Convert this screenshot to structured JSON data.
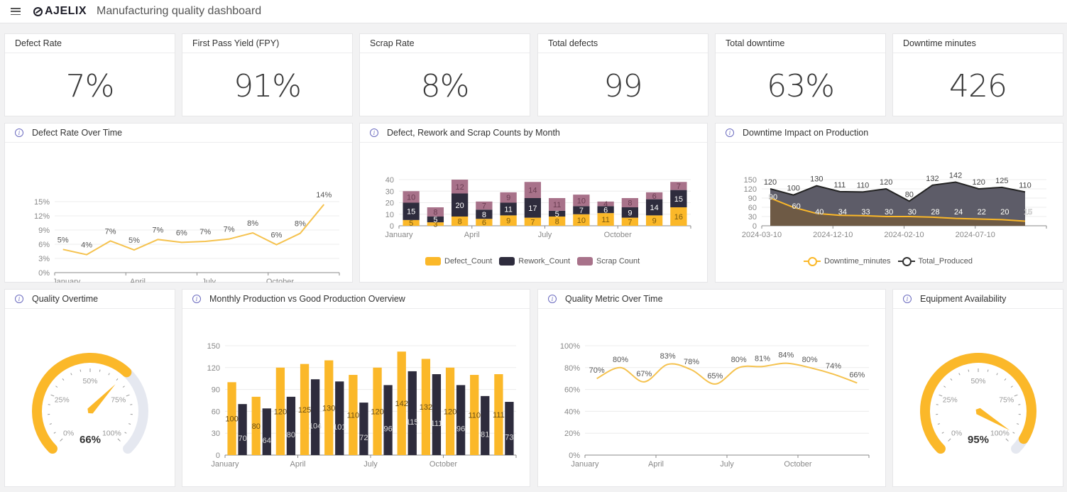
{
  "header": {
    "menu_icon": "hamburger-icon",
    "logo_text": "AJELIX",
    "title": "Manufacturing quality dashboard"
  },
  "kpis": [
    {
      "label": "Defect Rate",
      "value": "7%"
    },
    {
      "label": "First Pass Yield (FPY)",
      "value": "91%"
    },
    {
      "label": "Scrap Rate",
      "value": "8%"
    },
    {
      "label": "Total defects",
      "value": "99"
    },
    {
      "label": "Total downtime",
      "value": "63%"
    },
    {
      "label": "Downtime minutes",
      "value": "426"
    }
  ],
  "colors": {
    "accent": "#fbb829",
    "dark": "#2e2c3d",
    "scrap": "#a8728a",
    "area_dark": "#5d5c68",
    "area_brown": "#6e5a45",
    "grid": "#ececec"
  },
  "chart_data": [
    {
      "id": "defect_rate",
      "title": "Defect Rate Over Time",
      "type": "line",
      "categories": [
        "January",
        "February",
        "March",
        "April",
        "May",
        "June",
        "July",
        "August",
        "September",
        "October",
        "November",
        "December"
      ],
      "x_tick_labels": [
        "January",
        "April",
        "July",
        "October"
      ],
      "values": [
        4.9,
        3.8,
        6.7,
        4.8,
        7.0,
        6.4,
        6.6,
        7.1,
        8.4,
        5.9,
        8.3,
        14.4
      ],
      "data_labels": [
        "5%",
        "4%",
        "7%",
        "5%",
        "7%",
        "6%",
        "7%",
        "7%",
        "8%",
        "6%",
        "8%",
        "14%"
      ],
      "y_ticks": [
        "0%",
        "3%",
        "6%",
        "9%",
        "12%",
        "15%"
      ],
      "ylim": [
        0,
        15
      ],
      "grid": true
    },
    {
      "id": "counts_by_month",
      "title": "Defect, Rework and Scrap Counts by Month",
      "type": "bar",
      "stacked": true,
      "categories": [
        "January",
        "February",
        "March",
        "April",
        "May",
        "June",
        "July",
        "August",
        "September",
        "October",
        "November",
        "December"
      ],
      "x_tick_labels": [
        "January",
        "April",
        "July",
        "October"
      ],
      "series": [
        {
          "name": "Defect_Count",
          "values": [
            5,
            3,
            8,
            6,
            9,
            7,
            8,
            10,
            11,
            7,
            9,
            16
          ]
        },
        {
          "name": "Rework_Count",
          "values": [
            15,
            5,
            20,
            8,
            11,
            17,
            5,
            7,
            6,
            9,
            14,
            15
          ]
        },
        {
          "name": "Scrap Count",
          "values": [
            10,
            8,
            12,
            7,
            9,
            14,
            11,
            10,
            4,
            8,
            6,
            7
          ]
        }
      ],
      "y_ticks": [
        "0",
        "10",
        "20",
        "30",
        "40"
      ],
      "ylim": [
        0,
        40
      ],
      "legend": "bottom",
      "grid": true
    },
    {
      "id": "downtime_impact",
      "title": "Downtime Impact on Production",
      "type": "area",
      "x_tick_labels": [
        "2024-03-10",
        "2024-12-10",
        "2024-02-10",
        "2024-07-10"
      ],
      "series": [
        {
          "name": "Downtime_minutes",
          "values": [
            90,
            60,
            40,
            34,
            33,
            30,
            30,
            28,
            24,
            22,
            20,
            15
          ]
        },
        {
          "name": "Total_Produced",
          "values": [
            120,
            100,
            130,
            111,
            110,
            120,
            80,
            132,
            142,
            120,
            125,
            110
          ]
        }
      ],
      "y_ticks": [
        "0",
        "30",
        "60",
        "90",
        "120",
        "150"
      ],
      "ylim": [
        0,
        150
      ],
      "legend": "bottom",
      "grid": true
    },
    {
      "id": "quality_overtime",
      "title": "Quality Overtime",
      "type": "gauge",
      "value": 66,
      "value_label": "66%",
      "tick_labels": [
        "0%",
        "25%",
        "50%",
        "75%",
        "100%"
      ],
      "range": [
        0,
        100
      ]
    },
    {
      "id": "production_vs_good",
      "title": "Monthly Production vs Good Production Overview",
      "type": "bar",
      "categories": [
        "January",
        "February",
        "March",
        "April",
        "May",
        "June",
        "July",
        "August",
        "September",
        "October",
        "November",
        "December"
      ],
      "x_tick_labels": [
        "January",
        "April",
        "July",
        "October"
      ],
      "series": [
        {
          "name": "Production",
          "values": [
            100,
            80,
            120,
            125,
            130,
            110,
            120,
            142,
            132,
            120,
            110,
            111
          ]
        },
        {
          "name": "Good Production",
          "values": [
            70,
            64,
            80,
            104,
            101,
            72,
            96,
            115,
            111,
            96,
            81,
            73
          ]
        }
      ],
      "y_ticks": [
        "0",
        "30",
        "60",
        "90",
        "120",
        "150"
      ],
      "ylim": [
        0,
        150
      ],
      "grid": true
    },
    {
      "id": "quality_metric",
      "title": "Quality Metric Over Time",
      "type": "line",
      "smooth": true,
      "categories": [
        "January",
        "February",
        "March",
        "April",
        "May",
        "June",
        "July",
        "August",
        "September",
        "October",
        "November",
        "December"
      ],
      "x_tick_labels": [
        "January",
        "April",
        "July",
        "October"
      ],
      "values": [
        70,
        80,
        67,
        83,
        78,
        65,
        80,
        81,
        84,
        80,
        74,
        66
      ],
      "data_labels": [
        "70%",
        "80%",
        "67%",
        "83%",
        "78%",
        "65%",
        "80%",
        "81%",
        "84%",
        "80%",
        "74%",
        "66%"
      ],
      "y_ticks": [
        "0%",
        "20%",
        "40%",
        "60%",
        "80%",
        "100%"
      ],
      "ylim": [
        0,
        100
      ],
      "grid": true
    },
    {
      "id": "equipment_availability",
      "title": "Equipment Availability",
      "type": "gauge",
      "value": 95,
      "value_label": "95%",
      "tick_labels": [
        "0%",
        "25%",
        "50%",
        "75%",
        "100%"
      ],
      "range": [
        0,
        100
      ]
    }
  ]
}
